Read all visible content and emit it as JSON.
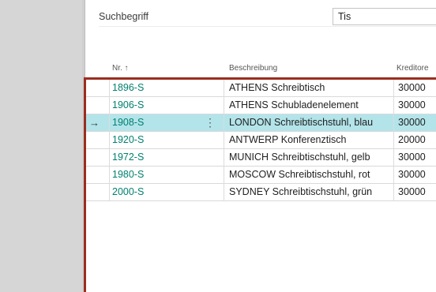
{
  "search": {
    "label": "Suchbegriff",
    "value": "Tis"
  },
  "columns": {
    "nr": "Nr. ↑",
    "description": "Beschreibung",
    "vendor": "Kreditore"
  },
  "rows": [
    {
      "nr": "1896-S",
      "description": "ATHENS Schreibtisch",
      "vendor": "30000"
    },
    {
      "nr": "1906-S",
      "description": "ATHENS Schubladenelement",
      "vendor": "30000"
    },
    {
      "nr": "1908-S",
      "description": "LONDON Schreibtischstuhl, blau",
      "vendor": "30000",
      "selected": true,
      "marker": "→",
      "actions": "⋮"
    },
    {
      "nr": "1920-S",
      "description": "ANTWERP Konferenztisch",
      "vendor": "20000"
    },
    {
      "nr": "1972-S",
      "description": "MUNICH Schreibtischstuhl, gelb",
      "vendor": "30000"
    },
    {
      "nr": "1980-S",
      "description": "MOSCOW Schreibtischstuhl, rot",
      "vendor": "30000"
    },
    {
      "nr": "2000-S",
      "description": "SYDNEY Schreibtischstuhl, grün",
      "vendor": "30000"
    }
  ],
  "colors": {
    "link": "#00806f",
    "selected_row": "#b3e4ea",
    "focus_border": "#9b2d1f"
  }
}
